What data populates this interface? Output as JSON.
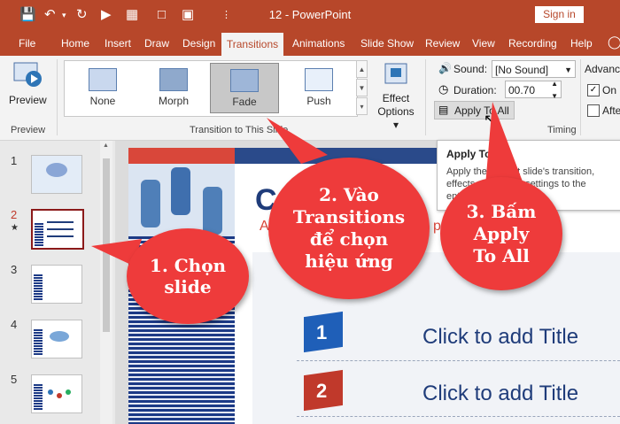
{
  "window": {
    "title": "12  -  PowerPoint",
    "signin": "Sign in"
  },
  "tabs": {
    "file": "File",
    "home": "Home",
    "insert": "Insert",
    "draw": "Draw",
    "design": "Design",
    "transitions": "Transitions",
    "animations": "Animations",
    "slideshow": "Slide Show",
    "review": "Review",
    "view": "View",
    "recording": "Recording",
    "help": "Help"
  },
  "ribbon": {
    "preview_button": "Preview",
    "preview_group": "Preview",
    "gallery": [
      "None",
      "Morph",
      "Fade",
      "Push"
    ],
    "effect_options": [
      "Effect",
      "Options ▾"
    ],
    "transition_group": "Transition to This Slide",
    "sound_label": "Sound:",
    "sound_value": "[No Sound]",
    "duration_label": "Duration:",
    "duration_value": "00.70",
    "apply_all": "Apply To All",
    "timing_group": "Timing",
    "advance_label": "Advanc",
    "on_label": "On",
    "after_label": "Afte"
  },
  "slides": {
    "numbers": [
      "1",
      "2",
      "3",
      "4",
      "5"
    ],
    "selected_star": "★"
  },
  "slide": {
    "title_letter": "C",
    "subtitle_fragment_a": "A",
    "subtitle_fragment_p": "p",
    "items": [
      {
        "num": "1",
        "text": "Click to add Title",
        "color": "#1f5fb8"
      },
      {
        "num": "2",
        "text": "Click to add Title",
        "color": "#c0392b"
      }
    ]
  },
  "tooltip": {
    "title": "Apply To",
    "lines": [
      "Apply the current slide's transition,",
      "effects and timing settings to the",
      "entire presentation."
    ]
  },
  "callouts": {
    "step1": [
      "1. Chọn",
      "slide"
    ],
    "step2": [
      "2. Vào",
      "Transitions",
      "để chọn",
      "hiệu ứng"
    ],
    "step3": [
      "3. Bấm",
      "Apply",
      "To All"
    ]
  },
  "colors": {
    "accent": "#b7472a",
    "callout": "#ee3b3b"
  }
}
